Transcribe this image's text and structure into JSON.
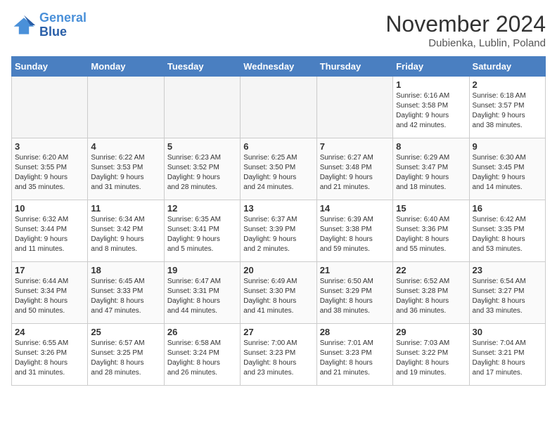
{
  "logo": {
    "line1": "General",
    "line2": "Blue"
  },
  "title": "November 2024",
  "location": "Dubienka, Lublin, Poland",
  "days_of_week": [
    "Sunday",
    "Monday",
    "Tuesday",
    "Wednesday",
    "Thursday",
    "Friday",
    "Saturday"
  ],
  "weeks": [
    [
      {
        "day": "",
        "info": ""
      },
      {
        "day": "",
        "info": ""
      },
      {
        "day": "",
        "info": ""
      },
      {
        "day": "",
        "info": ""
      },
      {
        "day": "",
        "info": ""
      },
      {
        "day": "1",
        "info": "Sunrise: 6:16 AM\nSunset: 3:58 PM\nDaylight: 9 hours\nand 42 minutes."
      },
      {
        "day": "2",
        "info": "Sunrise: 6:18 AM\nSunset: 3:57 PM\nDaylight: 9 hours\nand 38 minutes."
      }
    ],
    [
      {
        "day": "3",
        "info": "Sunrise: 6:20 AM\nSunset: 3:55 PM\nDaylight: 9 hours\nand 35 minutes."
      },
      {
        "day": "4",
        "info": "Sunrise: 6:22 AM\nSunset: 3:53 PM\nDaylight: 9 hours\nand 31 minutes."
      },
      {
        "day": "5",
        "info": "Sunrise: 6:23 AM\nSunset: 3:52 PM\nDaylight: 9 hours\nand 28 minutes."
      },
      {
        "day": "6",
        "info": "Sunrise: 6:25 AM\nSunset: 3:50 PM\nDaylight: 9 hours\nand 24 minutes."
      },
      {
        "day": "7",
        "info": "Sunrise: 6:27 AM\nSunset: 3:48 PM\nDaylight: 9 hours\nand 21 minutes."
      },
      {
        "day": "8",
        "info": "Sunrise: 6:29 AM\nSunset: 3:47 PM\nDaylight: 9 hours\nand 18 minutes."
      },
      {
        "day": "9",
        "info": "Sunrise: 6:30 AM\nSunset: 3:45 PM\nDaylight: 9 hours\nand 14 minutes."
      }
    ],
    [
      {
        "day": "10",
        "info": "Sunrise: 6:32 AM\nSunset: 3:44 PM\nDaylight: 9 hours\nand 11 minutes."
      },
      {
        "day": "11",
        "info": "Sunrise: 6:34 AM\nSunset: 3:42 PM\nDaylight: 9 hours\nand 8 minutes."
      },
      {
        "day": "12",
        "info": "Sunrise: 6:35 AM\nSunset: 3:41 PM\nDaylight: 9 hours\nand 5 minutes."
      },
      {
        "day": "13",
        "info": "Sunrise: 6:37 AM\nSunset: 3:39 PM\nDaylight: 9 hours\nand 2 minutes."
      },
      {
        "day": "14",
        "info": "Sunrise: 6:39 AM\nSunset: 3:38 PM\nDaylight: 8 hours\nand 59 minutes."
      },
      {
        "day": "15",
        "info": "Sunrise: 6:40 AM\nSunset: 3:36 PM\nDaylight: 8 hours\nand 55 minutes."
      },
      {
        "day": "16",
        "info": "Sunrise: 6:42 AM\nSunset: 3:35 PM\nDaylight: 8 hours\nand 53 minutes."
      }
    ],
    [
      {
        "day": "17",
        "info": "Sunrise: 6:44 AM\nSunset: 3:34 PM\nDaylight: 8 hours\nand 50 minutes."
      },
      {
        "day": "18",
        "info": "Sunrise: 6:45 AM\nSunset: 3:33 PM\nDaylight: 8 hours\nand 47 minutes."
      },
      {
        "day": "19",
        "info": "Sunrise: 6:47 AM\nSunset: 3:31 PM\nDaylight: 8 hours\nand 44 minutes."
      },
      {
        "day": "20",
        "info": "Sunrise: 6:49 AM\nSunset: 3:30 PM\nDaylight: 8 hours\nand 41 minutes."
      },
      {
        "day": "21",
        "info": "Sunrise: 6:50 AM\nSunset: 3:29 PM\nDaylight: 8 hours\nand 38 minutes."
      },
      {
        "day": "22",
        "info": "Sunrise: 6:52 AM\nSunset: 3:28 PM\nDaylight: 8 hours\nand 36 minutes."
      },
      {
        "day": "23",
        "info": "Sunrise: 6:54 AM\nSunset: 3:27 PM\nDaylight: 8 hours\nand 33 minutes."
      }
    ],
    [
      {
        "day": "24",
        "info": "Sunrise: 6:55 AM\nSunset: 3:26 PM\nDaylight: 8 hours\nand 31 minutes."
      },
      {
        "day": "25",
        "info": "Sunrise: 6:57 AM\nSunset: 3:25 PM\nDaylight: 8 hours\nand 28 minutes."
      },
      {
        "day": "26",
        "info": "Sunrise: 6:58 AM\nSunset: 3:24 PM\nDaylight: 8 hours\nand 26 minutes."
      },
      {
        "day": "27",
        "info": "Sunrise: 7:00 AM\nSunset: 3:23 PM\nDaylight: 8 hours\nand 23 minutes."
      },
      {
        "day": "28",
        "info": "Sunrise: 7:01 AM\nSunset: 3:23 PM\nDaylight: 8 hours\nand 21 minutes."
      },
      {
        "day": "29",
        "info": "Sunrise: 7:03 AM\nSunset: 3:22 PM\nDaylight: 8 hours\nand 19 minutes."
      },
      {
        "day": "30",
        "info": "Sunrise: 7:04 AM\nSunset: 3:21 PM\nDaylight: 8 hours\nand 17 minutes."
      }
    ]
  ]
}
